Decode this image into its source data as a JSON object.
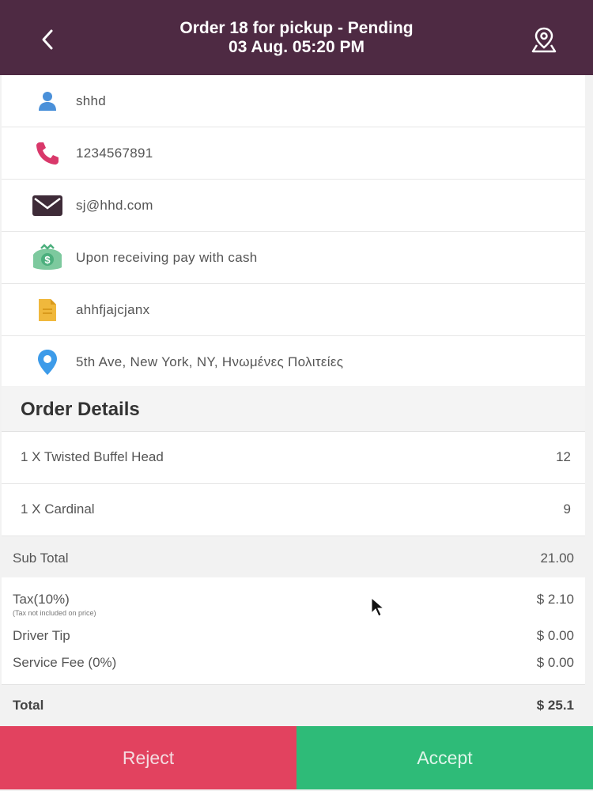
{
  "header": {
    "title_line1": "Order 18 for pickup - Pending",
    "title_line2": "03 Aug. 05:20 PM",
    "back_icon": "chevron-left-icon",
    "map_icon": "map-pin-icon"
  },
  "customer": {
    "name": "shhd",
    "phone": "1234567891",
    "email": "sj@hhd.com",
    "payment": "Upon receiving pay with cash",
    "note": "ahhfjajcjanx",
    "address": "5th Ave, New York, NY, Ηνωμένες Πολιτείες"
  },
  "order": {
    "heading": "Order Details",
    "items": [
      {
        "name": "1 X Twisted Buffel Head",
        "price": "12"
      },
      {
        "name": "1 X Cardinal",
        "price": "9"
      }
    ]
  },
  "summary": {
    "subtotal_label": "Sub Total",
    "subtotal_value": "21.00",
    "tax_label": "Tax(10%)",
    "tax_note": "(Tax not included on price)",
    "tax_value": "$ 2.10",
    "tip_label": "Driver Tip",
    "tip_value": "$ 0.00",
    "fee_label": "Service Fee (0%)",
    "fee_value": "$ 0.00",
    "total_label": "Total",
    "total_value": "$ 25.1"
  },
  "actions": {
    "reject": "Reject",
    "accept": "Accept"
  },
  "colors": {
    "header_bg": "#4e2a43",
    "reject": "#e2425f",
    "accept": "#2ebb78"
  }
}
